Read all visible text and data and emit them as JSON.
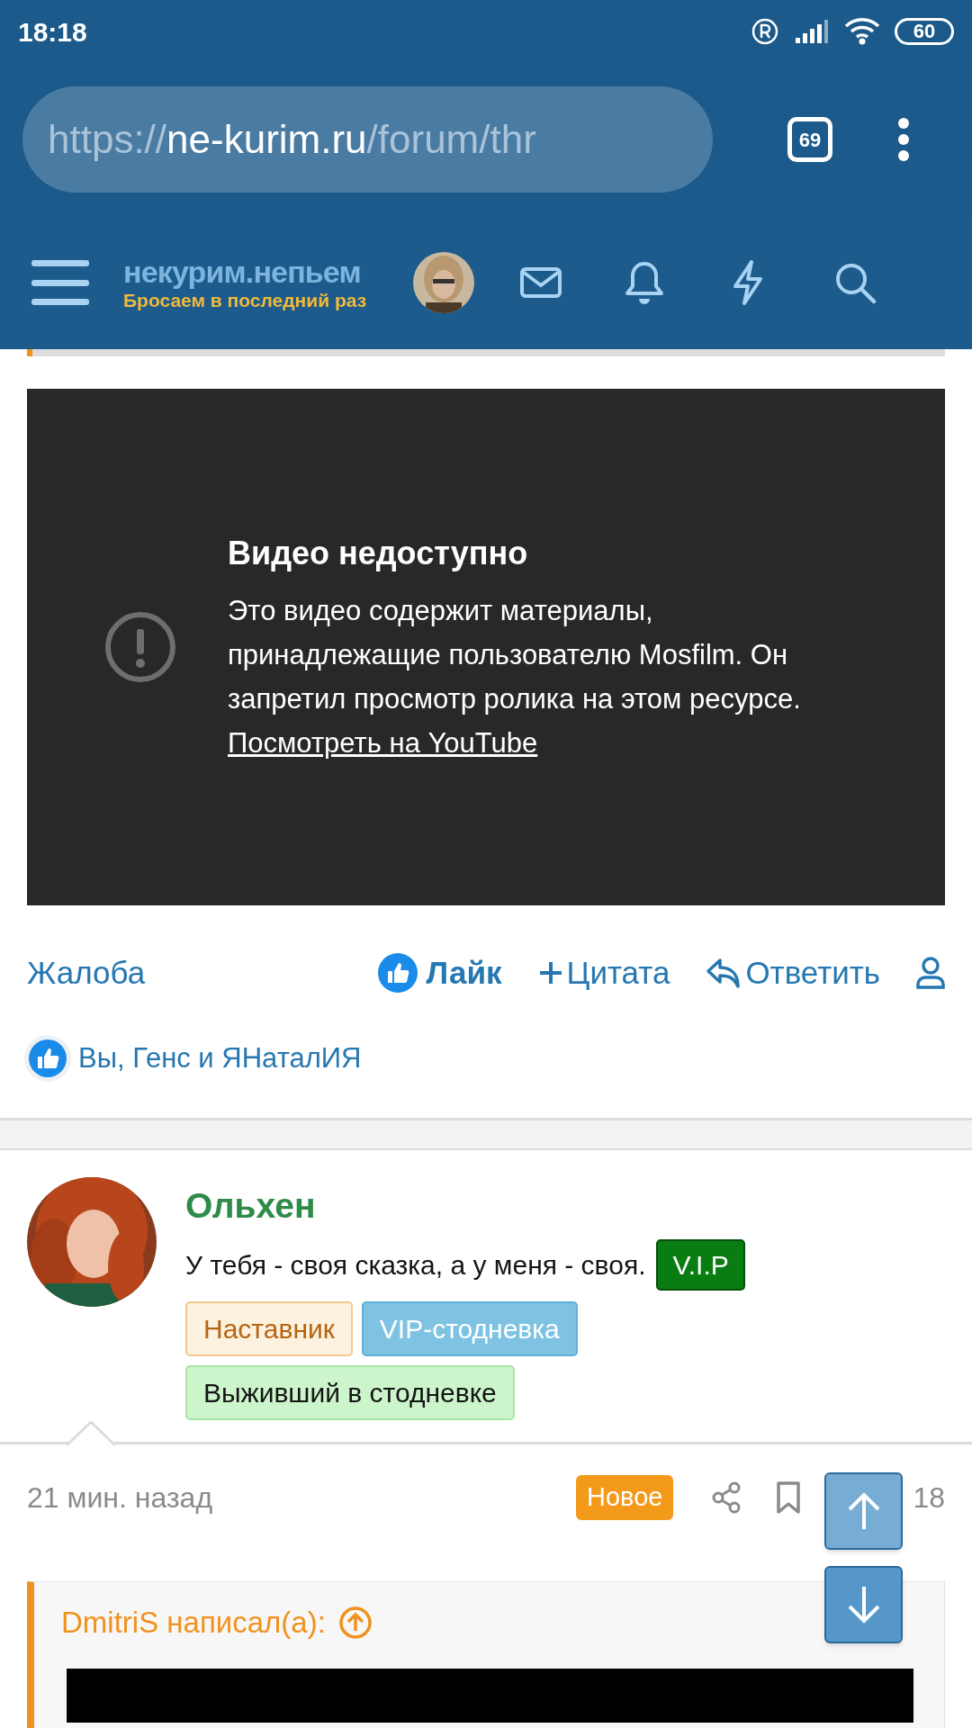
{
  "status_bar": {
    "time": "18:18",
    "battery": "60"
  },
  "browser": {
    "url_scheme": "https://",
    "url_host": "ne-kurim.ru",
    "url_path": "/forum/thr",
    "tab_count": "69"
  },
  "site_header": {
    "logo_title": "некурим.непьем",
    "logo_tagline": "Бросаем в последний раз"
  },
  "video": {
    "title": "Видео недоступно",
    "message": "Это видео содержит материалы, принадлежащие пользователю Mosfilm. Он запретил просмотр ролика на этом ресурсе.",
    "link": "Посмотреть на YouTube"
  },
  "post_actions": {
    "report": "Жалоба",
    "like": "Лайк",
    "liked": true,
    "quote": "Цитата",
    "reply": "Ответить"
  },
  "reactions": {
    "text": "Вы, Генс и ЯНаталИЯ"
  },
  "next_post": {
    "author": "Ольхен",
    "signature": "У тебя - своя сказка, а у меня - своя.",
    "badges": [
      {
        "label": "V.I.P",
        "color": "#0a7d12"
      },
      {
        "label": "Наставник",
        "color": "#fdf1e0"
      },
      {
        "label": "VIP-стодневка",
        "color": "#7ec3e2"
      },
      {
        "label": "Выживший в стодневке",
        "color": "#cdf5cc"
      }
    ],
    "time": "21 мин. назад",
    "new_label": "Новое",
    "number": "18",
    "quote_author": "DmitriS написал(а):"
  }
}
